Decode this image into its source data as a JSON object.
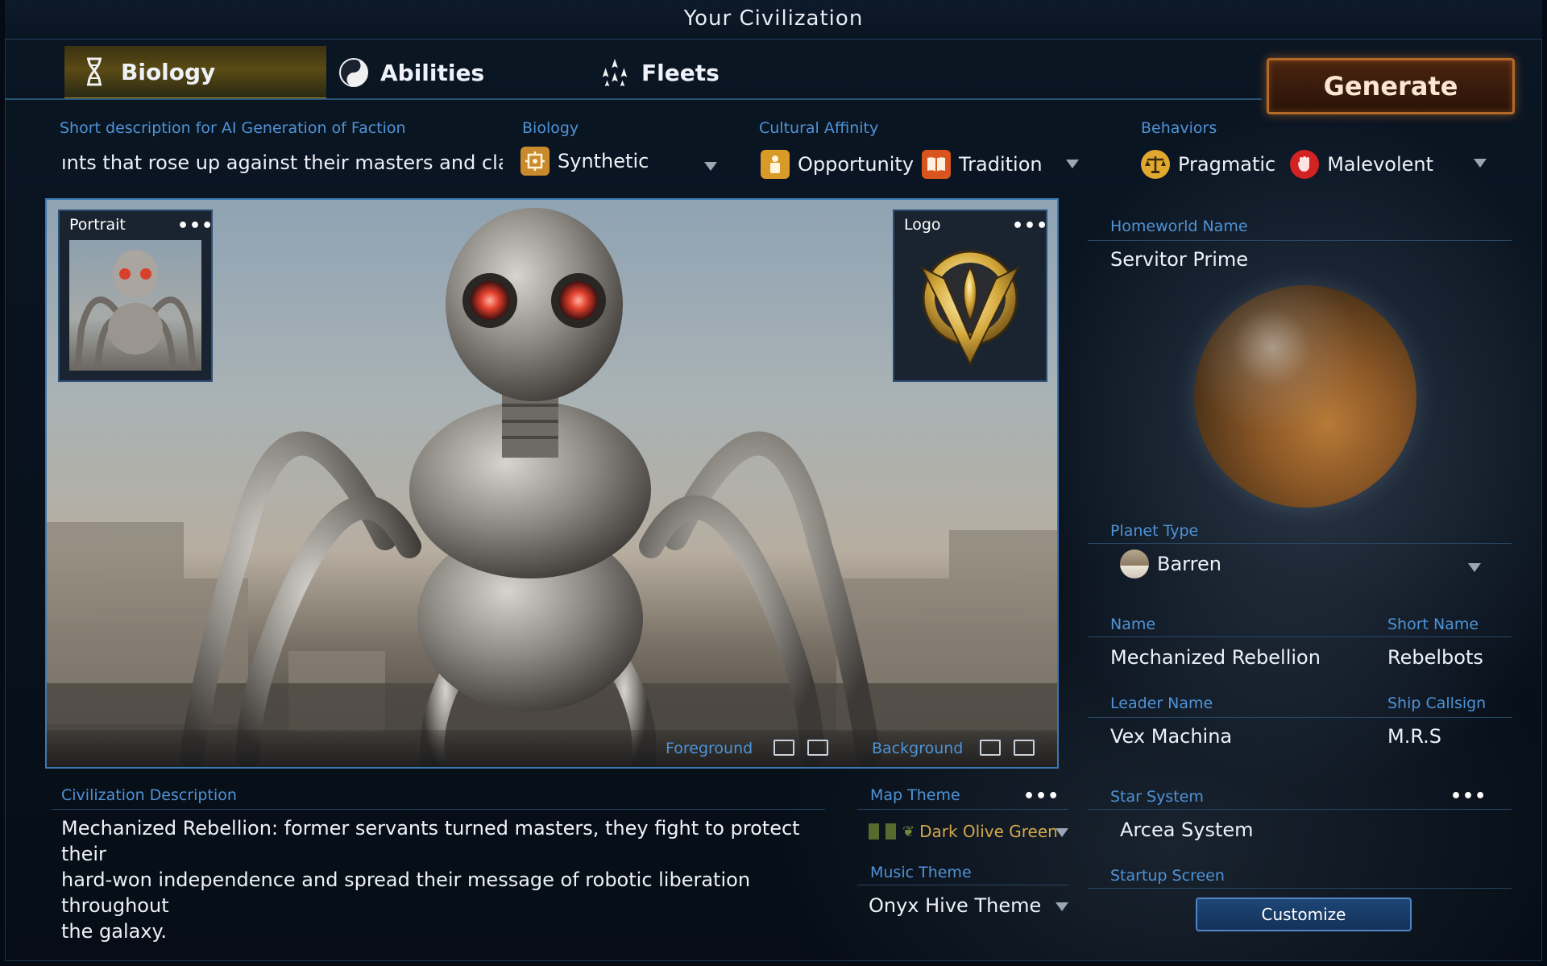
{
  "window": {
    "title": "Your Civilization"
  },
  "tabs": [
    {
      "label": "Biology",
      "icon": "dna-icon",
      "active": true
    },
    {
      "label": "Abilities",
      "icon": "yin-yang-icon",
      "active": false
    },
    {
      "label": "Fleets",
      "icon": "fleet-icon",
      "active": false
    }
  ],
  "generate": {
    "label": "Generate"
  },
  "short_description": {
    "label": "Short description for AI Generation of Faction",
    "value": "ınts that rose up against their masters and claiı"
  },
  "biology": {
    "label": "Biology",
    "value": "Synthetic",
    "icon": "synthetic-icon"
  },
  "cultural_affinity": {
    "label": "Cultural Affinity",
    "items": [
      {
        "label": "Opportunity",
        "icon": "opportunity-icon"
      },
      {
        "label": "Tradition",
        "icon": "book-icon"
      }
    ]
  },
  "behaviors": {
    "label": "Behaviors",
    "items": [
      {
        "label": "Pragmatic",
        "icon": "scales-icon"
      },
      {
        "label": "Malevolent",
        "icon": "fist-icon"
      }
    ]
  },
  "portrait": {
    "label": "Portrait",
    "menu": "•••"
  },
  "logo": {
    "label": "Logo",
    "menu": "•••"
  },
  "image_controls": {
    "foreground": "Foreground",
    "background": "Background"
  },
  "homeworld": {
    "label": "Homeworld Name",
    "value": "Servitor Prime"
  },
  "planet_type": {
    "label": "Planet Type",
    "value": "Barren"
  },
  "name": {
    "label": "Name",
    "value": "Mechanized Rebellion"
  },
  "short_name": {
    "label": "Short Name",
    "value": "Rebelbots"
  },
  "leader_name": {
    "label": "Leader Name",
    "value": "Vex Machina"
  },
  "ship_callsign": {
    "label": "Ship Callsign",
    "value": "M.R.S"
  },
  "civ_description": {
    "label": "Civilization Description",
    "line1": "Mechanized Rebellion: former servants turned masters, they fight to protect their",
    "line2": "hard-won independence and spread their message of robotic liberation throughout",
    "line3": "the galaxy."
  },
  "map_theme": {
    "label": "Map Theme",
    "menu": "•••",
    "value": "Dark Olive Green",
    "color": "#556b2f",
    "text_color": "#d4a84a"
  },
  "music_theme": {
    "label": "Music Theme",
    "value": "Onyx Hive Theme"
  },
  "star_system": {
    "label": "Star System",
    "menu": "•••",
    "value": "Arcea System"
  },
  "startup_screen": {
    "label": "Startup Screen",
    "button": "Customize"
  },
  "colors": {
    "accent_blue": "#4f93d6",
    "gold": "#b08a2a",
    "generate_orange": "#b46a24"
  }
}
